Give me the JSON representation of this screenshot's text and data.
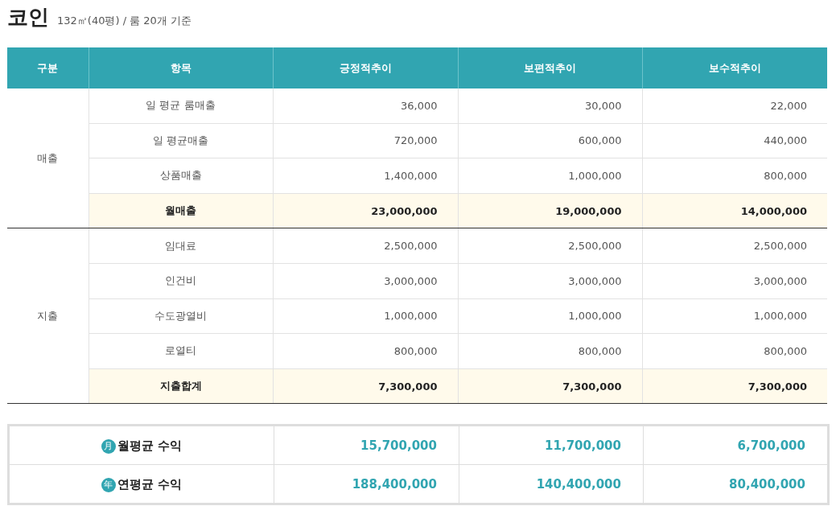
{
  "title": {
    "name": "코인",
    "detail": "132㎡(40평) / 룸 20개 기준"
  },
  "table": {
    "columns": [
      "구분",
      "항목",
      "긍정적추이",
      "보편적추이",
      "보수적추이"
    ],
    "groups": [
      {
        "label": "매출",
        "rows": [
          {
            "kind": "item",
            "label": "일 평균 룸매출",
            "values": [
              "36,000",
              "30,000",
              "22,000"
            ]
          },
          {
            "kind": "item",
            "label": "일 평균매출",
            "values": [
              "720,000",
              "600,000",
              "440,000"
            ]
          },
          {
            "kind": "item",
            "label": "상품매출",
            "values": [
              "1,400,000",
              "1,000,000",
              "800,000"
            ]
          },
          {
            "kind": "total",
            "label": "월매출",
            "values": [
              "23,000,000",
              "19,000,000",
              "14,000,000"
            ]
          }
        ]
      },
      {
        "label": "지출",
        "rows": [
          {
            "kind": "item",
            "label": "임대료",
            "values": [
              "2,500,000",
              "2,500,000",
              "2,500,000"
            ]
          },
          {
            "kind": "item",
            "label": "인건비",
            "values": [
              "3,000,000",
              "3,000,000",
              "3,000,000"
            ]
          },
          {
            "kind": "item",
            "label": "수도광열비",
            "values": [
              "1,000,000",
              "1,000,000",
              "1,000,000"
            ]
          },
          {
            "kind": "item",
            "label": "로열티",
            "values": [
              "800,000",
              "800,000",
              "800,000"
            ]
          },
          {
            "kind": "total",
            "label": "지출합계",
            "values": [
              "7,300,000",
              "7,300,000",
              "7,300,000"
            ]
          }
        ]
      }
    ]
  },
  "summary": [
    {
      "badge": "月",
      "label": "월평균 수익",
      "values": [
        "15,700,000",
        "11,700,000",
        "6,700,000"
      ]
    },
    {
      "badge": "年",
      "label": "연평균 수익",
      "values": [
        "188,400,000",
        "140,400,000",
        "80,400,000"
      ]
    }
  ]
}
